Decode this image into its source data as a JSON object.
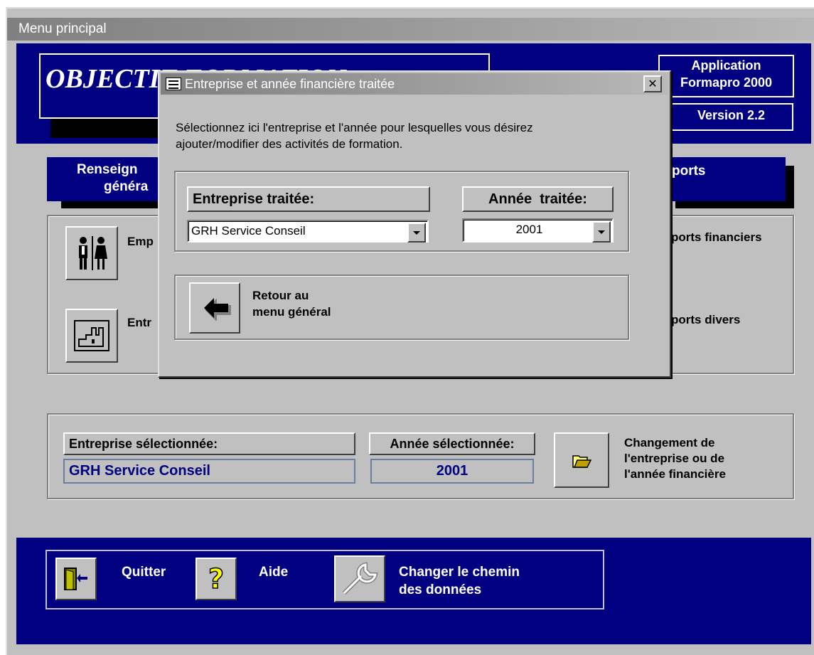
{
  "window": {
    "title": "Menu principal"
  },
  "banner": {
    "title": "OBJECTIF FORMATION"
  },
  "app_info": {
    "line1": "Application",
    "line2": "Formapro 2000",
    "version": "Version 2.2"
  },
  "sections": {
    "left_header_1": "Renseign",
    "left_header_2": "généra",
    "right_header": "ports"
  },
  "left_items": {
    "employes": "Emp",
    "entreprises": "Entr"
  },
  "right_items": {
    "rapports_financiers": "ports financiers",
    "rapports_divers": "ports divers"
  },
  "selection": {
    "company_label": "Entreprise sélectionnée:",
    "company_value": "GRH Service Conseil",
    "year_label": "Année sélectionnée:",
    "year_value": "2001",
    "change_line1": "Changement de",
    "change_line2": "l'entreprise ou de",
    "change_line3": "l'année financière"
  },
  "bottom": {
    "quit": "Quitter",
    "help": "Aide",
    "path_line1": "Changer le chemin",
    "path_line2": "des données"
  },
  "dialog": {
    "title": "Entreprise et année financière traitée",
    "instruction_line1": "Sélectionnez ici l'entreprise et l'année pour lesquelles vous désirez",
    "instruction_line2": "ajouter/modifier des activités de formation.",
    "company_label": "Entreprise traitée:",
    "company_value": "GRH Service Conseil",
    "year_label": "Année  traitée:",
    "year_value": "2001",
    "return_line1": "Retour au",
    "return_line2": "menu général"
  },
  "icons": {
    "employees": "people-icon",
    "companies": "factory-icon",
    "folder": "open-folder-icon",
    "quit": "door-exit-icon",
    "help": "question-mark-icon",
    "path": "wrench-icon",
    "return": "back-arrow-icon",
    "dialog": "form-icon",
    "close": "close-icon"
  },
  "colors": {
    "navy": "#000080",
    "face": "#c0c0c0",
    "text_blue": "#000080"
  }
}
